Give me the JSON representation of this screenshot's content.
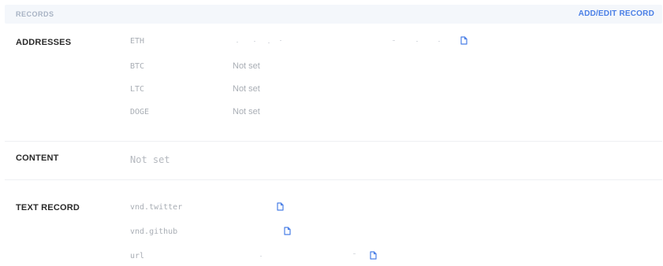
{
  "header": {
    "title": "RECORDS",
    "action": "ADD/EDIT RECORD"
  },
  "addresses": {
    "label": "ADDRESSES",
    "rows": [
      {
        "key": "ETH",
        "value": ""
      },
      {
        "key": "BTC",
        "value": "Not set"
      },
      {
        "key": "LTC",
        "value": "Not set"
      },
      {
        "key": "DOGE",
        "value": "Not set"
      }
    ]
  },
  "content": {
    "label": "CONTENT",
    "value": "Not set"
  },
  "text_record": {
    "label": "TEXT RECORD",
    "rows": [
      {
        "key": "vnd.twitter"
      },
      {
        "key": "vnd.github"
      },
      {
        "key": "url"
      }
    ]
  },
  "colors": {
    "accent": "#4a7fe6",
    "muted": "#a9aeb5",
    "header_bg": "#f4f7fb"
  },
  "icons": {
    "copy": "copy-icon"
  }
}
